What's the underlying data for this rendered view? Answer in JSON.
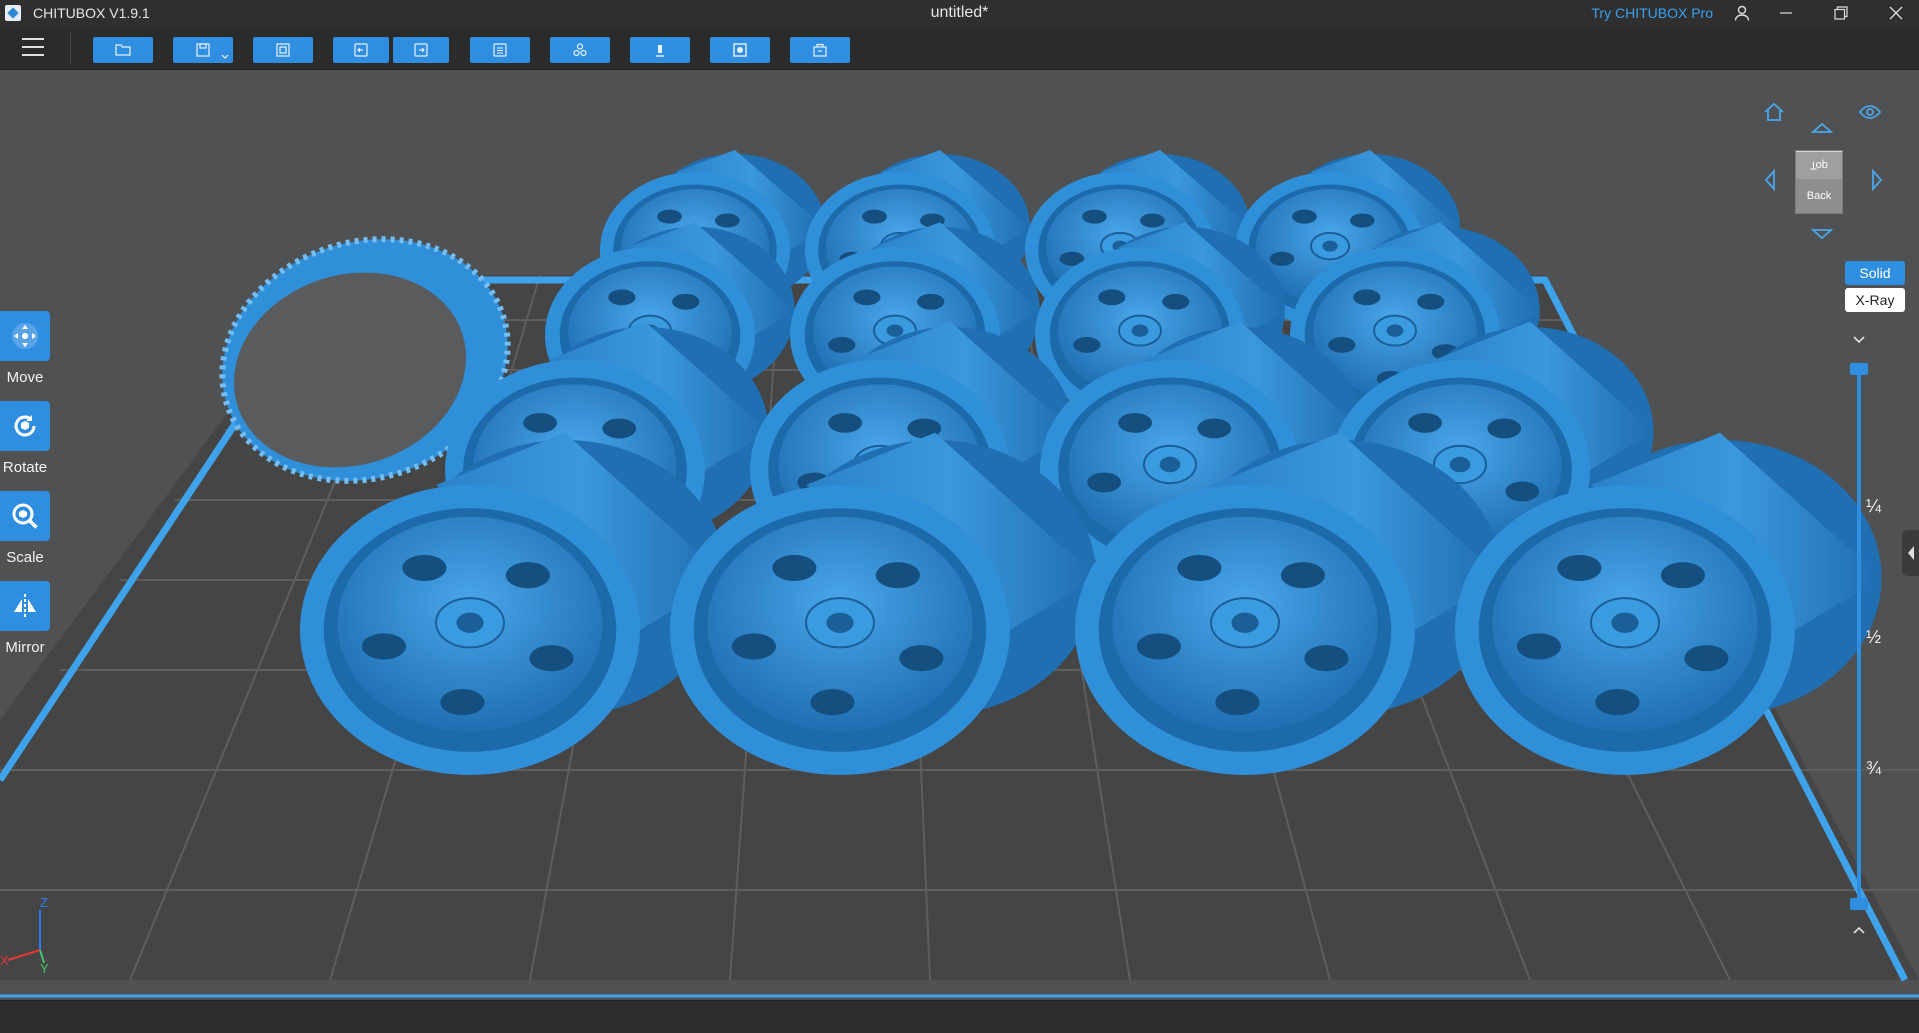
{
  "titlebar": {
    "app_name": "CHITUBOX V1.9.1",
    "document_title": "untitled*",
    "try_pro": "Try CHITUBOX Pro",
    "icons": [
      "app-logo-icon",
      "user-icon",
      "minimize-icon",
      "restore-icon",
      "close-icon"
    ]
  },
  "toolbar": {
    "buttons": [
      {
        "name": "open-file-button",
        "icon": "folder-icon"
      },
      {
        "name": "save-button",
        "icon": "save-icon"
      },
      {
        "name": "screenshot-button",
        "icon": "frame-icon"
      },
      {
        "name": "undo-button",
        "icon": "undo-icon"
      },
      {
        "name": "redo-button",
        "icon": "redo-icon"
      },
      {
        "name": "layers-button",
        "icon": "list-icon"
      },
      {
        "name": "arrange-button",
        "icon": "arrange-icon"
      },
      {
        "name": "supports-button",
        "icon": "support-icon"
      },
      {
        "name": "hollow-button",
        "icon": "hollow-icon"
      },
      {
        "name": "slice-button",
        "icon": "slice-icon"
      }
    ]
  },
  "tools": {
    "move": "Move",
    "rotate": "Rotate",
    "scale": "Scale",
    "mirror": "Mirror"
  },
  "viewcube": {
    "top": "Top",
    "back": "Back"
  },
  "render_mode": {
    "solid": "Solid",
    "xray": "X-Ray",
    "active": "Solid"
  },
  "layer_slider": {
    "ticks": [
      "¼",
      "½",
      "¾"
    ]
  },
  "axes": {
    "x": "X",
    "y": "Y",
    "z": "Z"
  },
  "colors": {
    "accent": "#2f8ee0",
    "model": "#2f8fd8",
    "viewport": "#505152",
    "plate": "#454545",
    "plate_grid": "#5c5c5c",
    "plate_border": "#3ea3ea"
  }
}
